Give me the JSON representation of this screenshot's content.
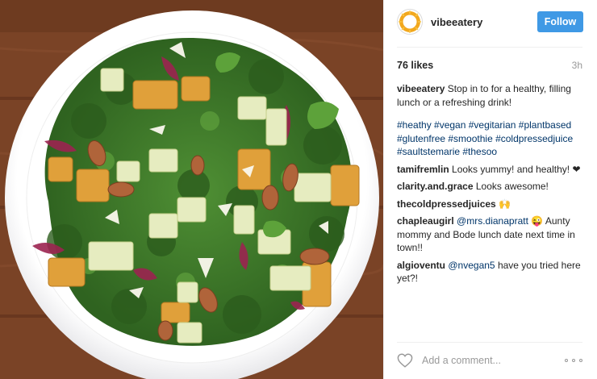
{
  "post": {
    "username": "vibeeatery",
    "follow_label": "Follow",
    "likes": "76 likes",
    "time": "3h",
    "avatar_icon": "vibe-sun-logo",
    "photo_description_icon": "salad-plate-image"
  },
  "caption": {
    "username": "vibeeatery",
    "text": "Stop in to for a healthy, filling lunch or a refreshing drink!",
    "hashtags": "#heathy #vegan #vegitarian #plantbased #glutenfree #smoothie #coldpressedjuice #saultstemarie #thesoo"
  },
  "comments": [
    {
      "username": "tamifremlin",
      "text": "Looks yummy! and healthy! ❤"
    },
    {
      "username": "clarity.and.grace",
      "text": "Looks awesome!"
    },
    {
      "username": "thecoldpressedjuices",
      "text": "🙌"
    },
    {
      "username": "chapleaugirl",
      "mention": "@mrs.dianapratt",
      "text": "😜 Aunty mommy and Bode lunch date next time in town!!"
    },
    {
      "username": "algioventu",
      "mention": "@nvegan5",
      "text": "have you tried here yet?!"
    }
  ],
  "footer": {
    "comment_placeholder": "Add a comment...",
    "like_icon": "heart-icon",
    "more_icon": "more-options-icon"
  },
  "colors": {
    "follow_button": "#3f99e5",
    "hashtag_link": "#003569",
    "wood": "#7a4326",
    "kale": "#3f7a2a"
  }
}
